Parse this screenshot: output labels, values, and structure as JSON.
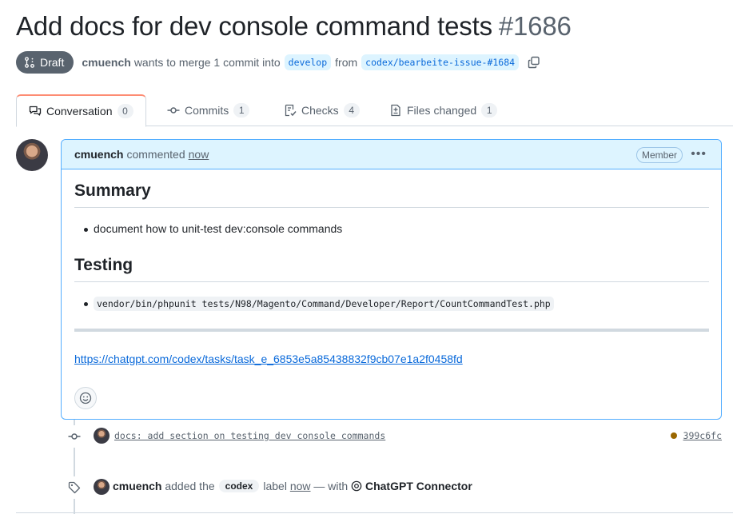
{
  "pr": {
    "title": "Add docs for dev console command tests",
    "number": "#1686",
    "status": "Draft",
    "author": "cmuench",
    "merge_text": "wants to merge 1 commit into",
    "base_branch": "develop",
    "from_text": "from",
    "head_branch": "codex/bearbeite-issue-#1684"
  },
  "tabs": [
    {
      "label": "Conversation",
      "count": "0"
    },
    {
      "label": "Commits",
      "count": "1"
    },
    {
      "label": "Checks",
      "count": "4"
    },
    {
      "label": "Files changed",
      "count": "1"
    }
  ],
  "comment": {
    "author": "cmuench",
    "action": "commented",
    "time": "now",
    "role": "Member",
    "summary_heading": "Summary",
    "summary_item": "document how to unit-test dev:console commands",
    "testing_heading": "Testing",
    "testing_item": "vendor/bin/phpunit tests/N98/Magento/Command/Developer/Report/CountCommandTest.php",
    "link": "https://chatgpt.com/codex/tasks/task_e_6853e5a85438832f9cb07e1a2f0458fd"
  },
  "timeline": {
    "commit_message": "docs: add section on testing dev console commands",
    "commit_sha": "399c6fc",
    "label_event": {
      "actor": "cmuench",
      "text_added": "added the",
      "label": "codex",
      "text_label": "label",
      "time": "now",
      "text_with": "— with",
      "app": "ChatGPT Connector"
    }
  },
  "colors": {
    "accent": "#0969da",
    "draft": "#59636e",
    "active_tab": "#fd8c73",
    "comment_header": "#ddf4ff",
    "pending_status": "#9a6700"
  }
}
